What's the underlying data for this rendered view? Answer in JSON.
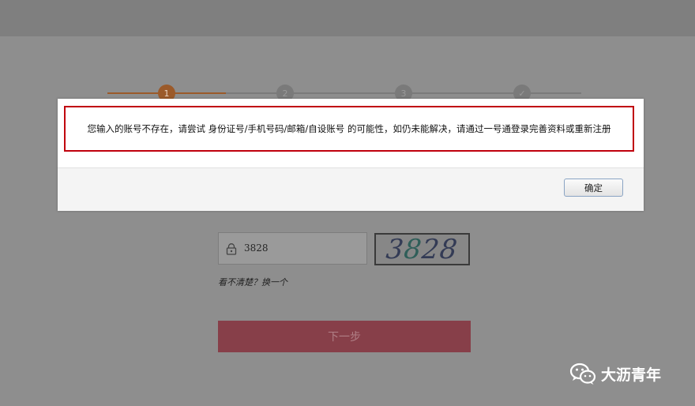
{
  "steps": [
    {
      "label": "1",
      "active": true
    },
    {
      "label": "2",
      "active": false
    },
    {
      "label": "3",
      "active": false
    },
    {
      "label": "✓",
      "active": false
    }
  ],
  "dialog": {
    "message": "您输入的账号不存在，请尝试 身份证号/手机号码/邮箱/自设账号 的可能性，如仍未能解决，请通过一号通登录完善资料或重新注册",
    "ok_label": "确定",
    "border_color": "#c0000d"
  },
  "captcha": {
    "input_value": "3828",
    "image_text_a": "3",
    "image_text_b": "8",
    "image_text_c": "28",
    "refresh_label": "看不清楚？换一个"
  },
  "next_button": {
    "label": "下一步",
    "color": "#873f49"
  },
  "watermark": {
    "text": "大沥青年",
    "icon": "wechat-icon"
  }
}
